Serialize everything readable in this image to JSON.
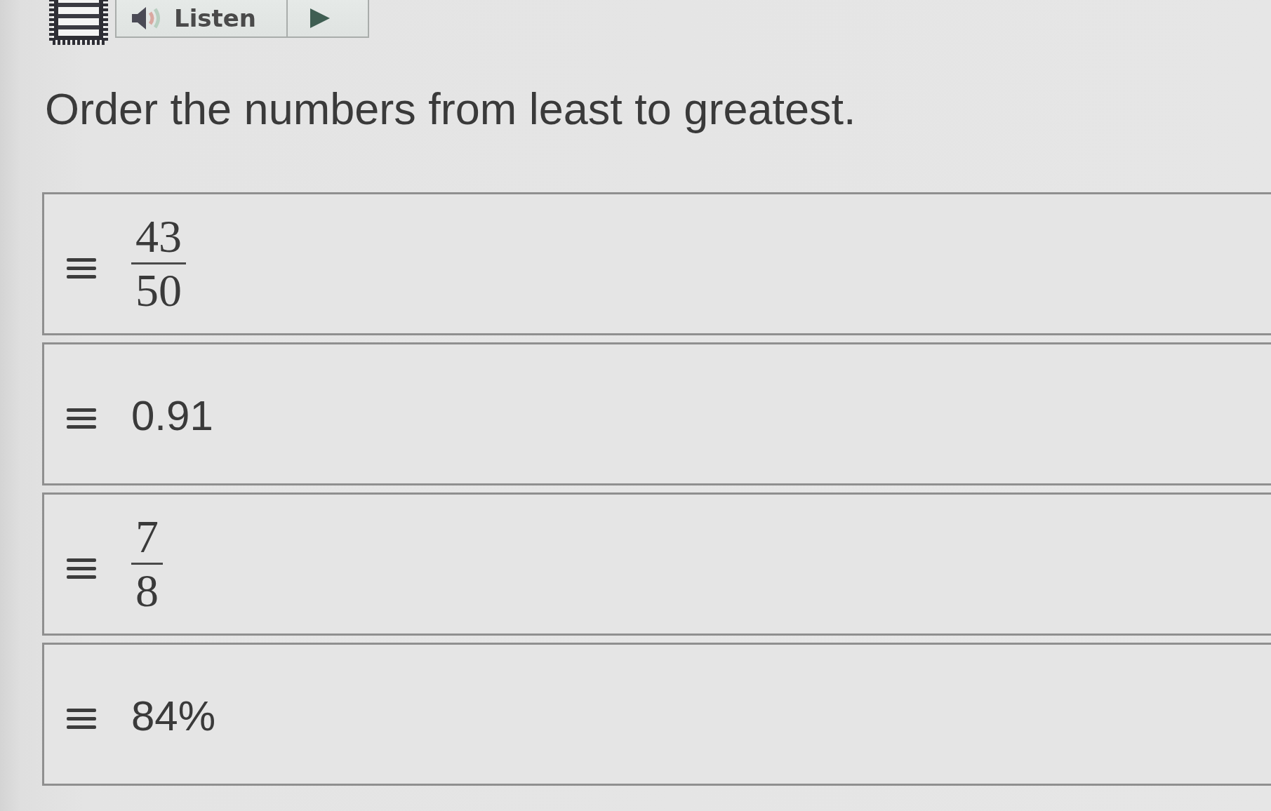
{
  "toolbar": {
    "listen_button": {
      "label": "Listen"
    }
  },
  "question": {
    "prompt": "Order the numbers from least to greatest."
  },
  "items": [
    {
      "kind": "fraction",
      "numerator": "43",
      "denominator": "50"
    },
    {
      "kind": "number",
      "value": "0.91"
    },
    {
      "kind": "fraction",
      "numerator": "7",
      "denominator": "8"
    },
    {
      "kind": "number",
      "value": "84%"
    }
  ]
}
